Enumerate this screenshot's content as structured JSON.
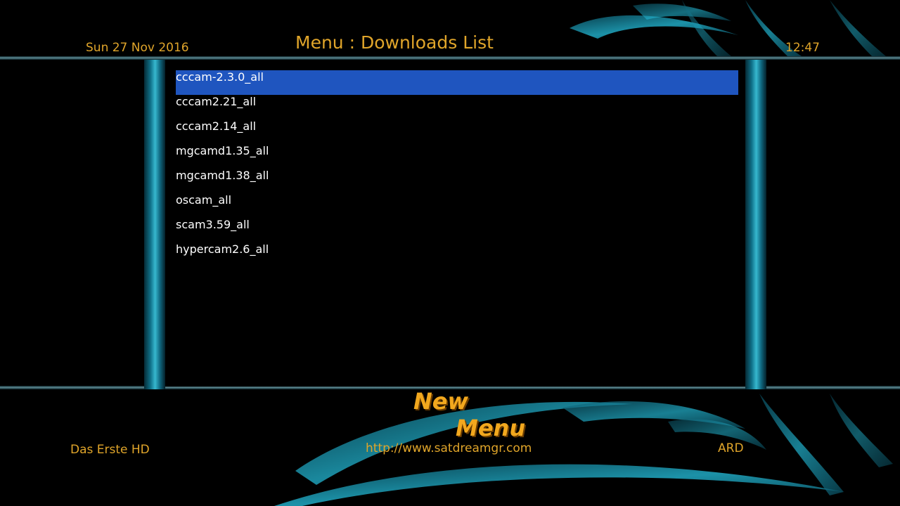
{
  "header": {
    "date": "Sun 27 Nov 2016",
    "title": "Menu : Downloads List",
    "time": "12:47"
  },
  "list": {
    "items": [
      {
        "label": "cccam-2.3.0_all",
        "selected": true
      },
      {
        "label": "cccam2.21_all"
      },
      {
        "label": "cccam2.14_all"
      },
      {
        "label": "mgcamd1.35_all"
      },
      {
        "label": "mgcamd1.38_all"
      },
      {
        "label": "oscam_all"
      },
      {
        "label": "scam3.59_all"
      },
      {
        "label": "hypercam2.6_all"
      }
    ]
  },
  "footer": {
    "channel": "Das Erste HD",
    "website": "http://www.satdreamgr.com",
    "provider": "ARD",
    "brand_line1": "New",
    "brand_line2": "Menu"
  },
  "colors": {
    "accent_text": "#e0a52a",
    "selection": "#1f55bf",
    "item_text": "#ffffff",
    "swirl": "#1aa3bd"
  }
}
